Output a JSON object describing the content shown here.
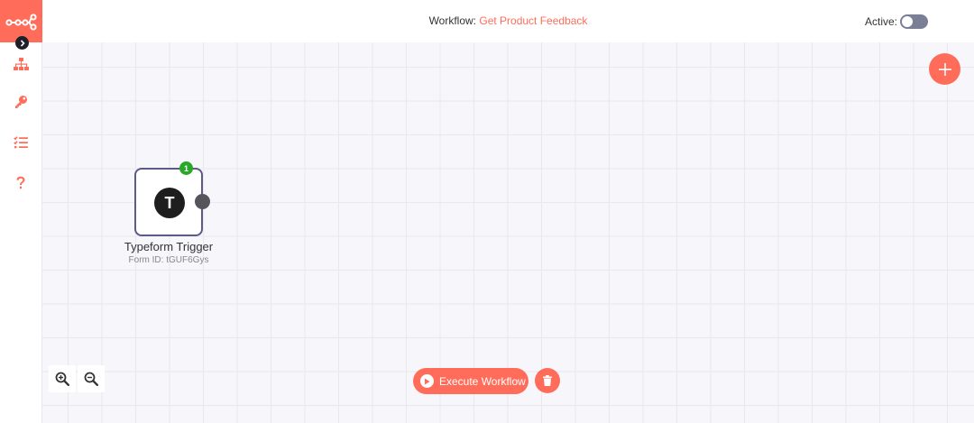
{
  "colors": {
    "accent": "#ff6d5a",
    "success": "#29a828"
  },
  "sidebar": {
    "logo_icon": "n8n-logo-icon",
    "expand_icon": "chevron-right-icon",
    "items": [
      {
        "name": "workflows",
        "icon": "sitemap-icon"
      },
      {
        "name": "credentials",
        "icon": "key-icon"
      },
      {
        "name": "executions",
        "icon": "tasks-list-icon"
      },
      {
        "name": "help",
        "icon": "question-icon"
      }
    ]
  },
  "header": {
    "workflow_label": "Workflow: ",
    "workflow_name": "Get Product Feedback",
    "active_label": "Active:",
    "active": false
  },
  "canvas": {
    "add_node_icon": "plus-icon",
    "node": {
      "name": "Typeform Trigger",
      "subtitle": "Form ID: tGUF6Gys",
      "icon_letter": "T",
      "badge": "1"
    }
  },
  "toolbar": {
    "zoom_in_icon": "zoom-in-icon",
    "zoom_out_icon": "zoom-out-icon",
    "execute_label": "Execute Workflow",
    "delete_icon": "trash-icon"
  }
}
